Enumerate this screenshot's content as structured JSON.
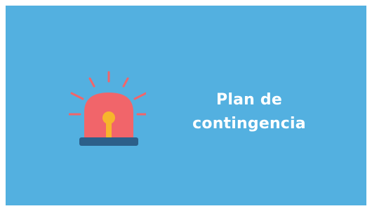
{
  "card": {
    "title_line1": "Plan de",
    "title_line2": "contingencia"
  },
  "colors": {
    "background": "#53b0e0",
    "siren_dome": "#f1656a",
    "siren_base": "#2c5f8a",
    "siren_light": "#f7b52c",
    "siren_rays": "#f1656a",
    "text": "#ffffff"
  },
  "icons": {
    "main": "emergency-siren-icon"
  }
}
